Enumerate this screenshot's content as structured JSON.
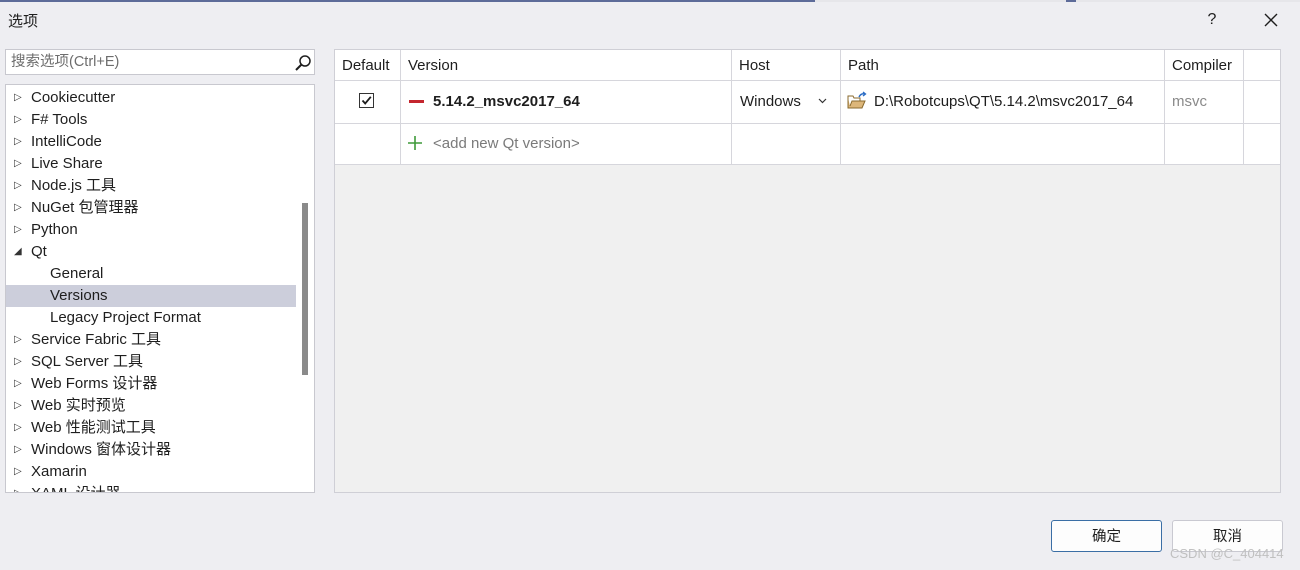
{
  "window": {
    "title": "选项",
    "help_label": "?",
    "close_label": "close"
  },
  "search": {
    "placeholder": "搜索选项(Ctrl+E)",
    "value": ""
  },
  "tree": {
    "items": [
      {
        "label": "Cookiecutter",
        "level": 0,
        "expanded": false,
        "selected": false
      },
      {
        "label": "F# Tools",
        "level": 0,
        "expanded": false,
        "selected": false
      },
      {
        "label": "IntelliCode",
        "level": 0,
        "expanded": false,
        "selected": false
      },
      {
        "label": "Live Share",
        "level": 0,
        "expanded": false,
        "selected": false
      },
      {
        "label": "Node.js 工具",
        "level": 0,
        "expanded": false,
        "selected": false
      },
      {
        "label": "NuGet 包管理器",
        "level": 0,
        "expanded": false,
        "selected": false
      },
      {
        "label": "Python",
        "level": 0,
        "expanded": false,
        "selected": false
      },
      {
        "label": "Qt",
        "level": 0,
        "expanded": true,
        "selected": false
      },
      {
        "label": "General",
        "level": 1,
        "expanded": null,
        "selected": false
      },
      {
        "label": "Versions",
        "level": 1,
        "expanded": null,
        "selected": true
      },
      {
        "label": "Legacy Project Format",
        "level": 1,
        "expanded": null,
        "selected": false
      },
      {
        "label": "Service Fabric 工具",
        "level": 0,
        "expanded": false,
        "selected": false
      },
      {
        "label": "SQL Server 工具",
        "level": 0,
        "expanded": false,
        "selected": false
      },
      {
        "label": "Web Forms 设计器",
        "level": 0,
        "expanded": false,
        "selected": false
      },
      {
        "label": "Web 实时预览",
        "level": 0,
        "expanded": false,
        "selected": false
      },
      {
        "label": "Web 性能测试工具",
        "level": 0,
        "expanded": false,
        "selected": false
      },
      {
        "label": "Windows 窗体设计器",
        "level": 0,
        "expanded": false,
        "selected": false
      },
      {
        "label": "Xamarin",
        "level": 0,
        "expanded": false,
        "selected": false
      },
      {
        "label": "XAML 设计器",
        "level": 0,
        "expanded": false,
        "selected": false
      }
    ]
  },
  "grid": {
    "columns": [
      "Default",
      "Version",
      "Host",
      "Path",
      "Compiler"
    ],
    "rows": [
      {
        "default_checked": true,
        "version": "5.14.2_msvc2017_64",
        "host": "Windows",
        "path": "D:\\Robotcups\\QT\\5.14.2\\msvc2017_64",
        "compiler": "msvc"
      }
    ],
    "add_row_label": "<add new Qt version>"
  },
  "buttons": {
    "ok": "确定",
    "cancel": "取消"
  },
  "watermark": "CSDN @C_404414",
  "colors": {
    "accent": "#3a6ea5",
    "selection": "#cccedb",
    "remove": "#c4262e",
    "add": "#3f9a3a"
  }
}
